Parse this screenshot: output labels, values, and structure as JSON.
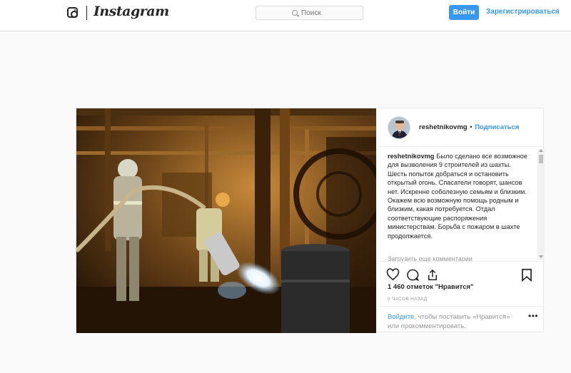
{
  "nav": {
    "wordmark": "Instagram",
    "search_placeholder": "Поиск",
    "login_label": "Войти",
    "signup_label": "Зарегистрироваться"
  },
  "post": {
    "username": "reshetnikovmg",
    "follow_label": "Подписаться",
    "caption": "Было сделано все возможное для вызволения 9 строителей из шахты. Шесть попыток добраться и остановить открытый огонь. Спасатели говорят, шансов нет. Искренне соболезную семьям и близким. Окажем всю возможную помощь родным и близким, какая потребуется. Отдал соответствующие распоряжения министерствам. Борьба с пожаром в шахте продолжается.",
    "load_more": "Загрузить еще комментарии",
    "likes": "1 460 отметок \"Нравится\"",
    "timestamp": "9 ЧАСОВ НАЗАД",
    "login_link": "Войдите",
    "login_rest": ", чтобы поставить «Нравится» или прокомментировать.",
    "more_label": "•••"
  },
  "colors": {
    "accent": "#3897f0",
    "text": "#262626",
    "muted": "#999999"
  },
  "icons": [
    "instagram-glyph-icon",
    "search-icon",
    "heart-icon",
    "comment-icon",
    "share-icon",
    "bookmark-icon",
    "more-options-icon"
  ]
}
